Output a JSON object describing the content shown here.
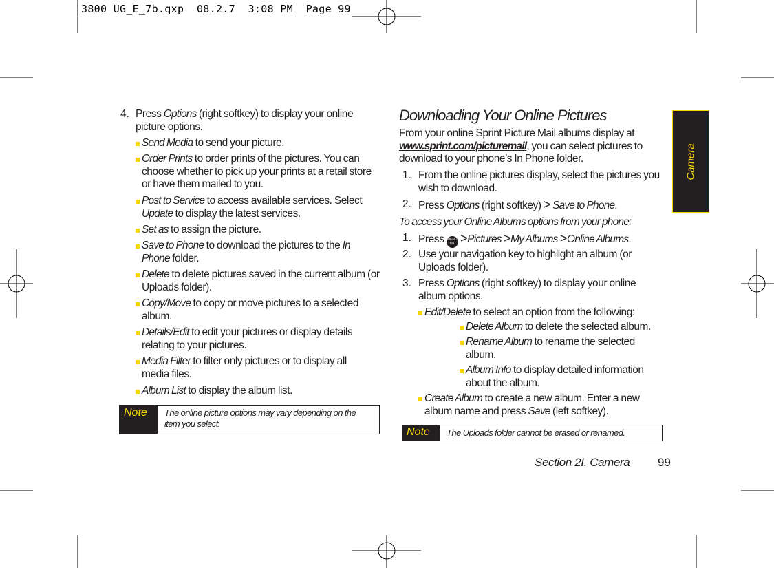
{
  "slug": "3800 UG_E_7b.qxp  08.2.7  3:08 PM  Page 99",
  "left": {
    "step4": {
      "num": "4.",
      "a": "Press ",
      "b": "Options",
      "c": " (right softkey) to display your online picture options."
    },
    "bullets": [
      {
        "term": "Send Media",
        "text": " to send your picture."
      },
      {
        "term": "Order Prints",
        "text": " to order prints of the pictures. You can choose whether to pick up your prints at a retail store or have them mailed to you."
      },
      {
        "term": "Post to Service",
        "text": " to access available services. Select ",
        "term2": "Update",
        "text2": " to display the latest services."
      },
      {
        "term": "Set as",
        "text": " to assign the picture."
      },
      {
        "term": "Save to Phone",
        "text": " to download the pictures to the ",
        "term2": "In Phone",
        "text2": " folder."
      },
      {
        "term": "Delete",
        "text": " to delete pictures saved in the current album (or Uploads folder)."
      },
      {
        "term": "Copy/Move",
        "text": " to copy or move pictures to a selected album."
      },
      {
        "term": "Details/Edit",
        "text": " to edit your pictures or display details relating to your pictures."
      },
      {
        "term": "Media Filter",
        "text": " to filter only pictures or to display all media files."
      },
      {
        "term": "Album List",
        "text": " to display the album list."
      }
    ],
    "note": {
      "label": "Note",
      "text": "The online picture options may vary depending on the item you select."
    }
  },
  "right": {
    "heading": "Downloading Your Online Pictures",
    "intro": {
      "a": "From your online Sprint Picture Mail albums display at ",
      "link": "www.sprint.com/picturemail",
      "b": ", you can select pictures to download to your phone’s In Phone folder."
    },
    "steps1": [
      {
        "num": "1.",
        "text": "From the online pictures display, select the pictures you wish to download."
      },
      {
        "num": "2.",
        "a": "Press ",
        "b": "Options",
        "c": " (right softkey) ",
        "sep": ">",
        "d": " Save to Phone",
        "e": "."
      }
    ],
    "subhead": "To access your Online Albums options from your phone:",
    "steps2": [
      {
        "num": "1.",
        "a": "Press ",
        "icon": "menu-ok-key-icon",
        "icon_top": "MENU",
        "icon_bottom": "OK",
        "path": [
          "Pictures",
          "My Albums",
          "Online Albums"
        ],
        "sep": ">",
        "end": "."
      },
      {
        "num": "2.",
        "text": "Use your navigation key to highlight an album (or Uploads folder)."
      },
      {
        "num": "3.",
        "a": "Press ",
        "b": "Options",
        "c": " (right softkey) to display your online album options."
      }
    ],
    "editdelete": {
      "term": "Edit/Delete",
      "text": " to select an option from the following:"
    },
    "sub": [
      {
        "term": "Delete Album",
        "text": " to delete the selected album."
      },
      {
        "term": "Rename Album",
        "text": " to rename the selected album."
      },
      {
        "term": "Album Info",
        "text": " to display detailed information about the album."
      }
    ],
    "create": {
      "term": "Create Album",
      "a": " to create a new album. Enter a new album name and press ",
      "b": "Save",
      "c": " (left softkey)."
    },
    "note": {
      "label": "Note",
      "text": "The Uploads folder cannot be erased or renamed."
    }
  },
  "tab": {
    "label": "Camera"
  },
  "footer": {
    "section": "Section 2I. Camera",
    "page": "99"
  },
  "colors": {
    "accent": "#f5d800",
    "ink": "#231f20"
  }
}
